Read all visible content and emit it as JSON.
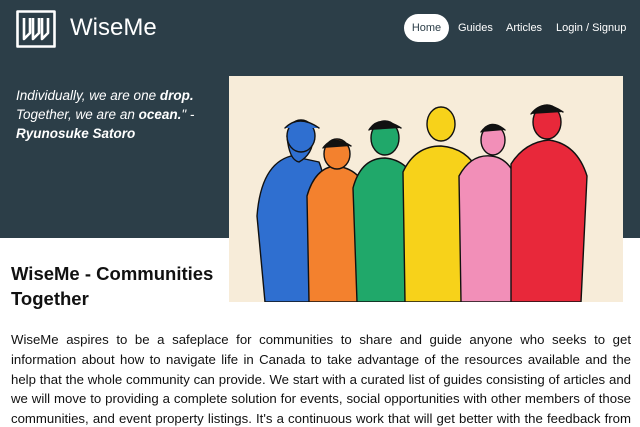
{
  "brand": {
    "name": "WiseMe"
  },
  "nav": [
    {
      "label": "Home",
      "active": true
    },
    {
      "label": "Guides"
    },
    {
      "label": "Articles"
    },
    {
      "label": "Login / Signup"
    }
  ],
  "hero": {
    "quote_line1_pre": "Individually, we are one ",
    "quote_line1_bold": "drop.",
    "quote_line2_pre": "Together, we are an ",
    "quote_line2_bold": "ocean.",
    "quote_line2_post": "\" -",
    "quote_author": "Ryunosuke Satoro"
  },
  "main": {
    "title": "WiseMe - Communities Together",
    "body": "WiseMe aspires to be a safeplace for communities to share and guide anyone who seeks to get information about how to navigate life in Canada to take advantage of the resources available and the help that the whole community can provide. We start with a curated list of guides consisting of articles and we will move to providing a complete solution for events, social opportunities with other members of those communities, and event property listings. It's a continuous work that will get better with the feedback from every user of the site. Learn and contribute and enjoy your time in Canada."
  },
  "colors": {
    "header_bg": "#2c3e48",
    "illustration_bg": "#f7ecd9",
    "blue": "#2f6fd0",
    "orange": "#f3812e",
    "green": "#20a86a",
    "yellow": "#f7d21a",
    "pink": "#f28fb8",
    "red": "#e8283a"
  }
}
